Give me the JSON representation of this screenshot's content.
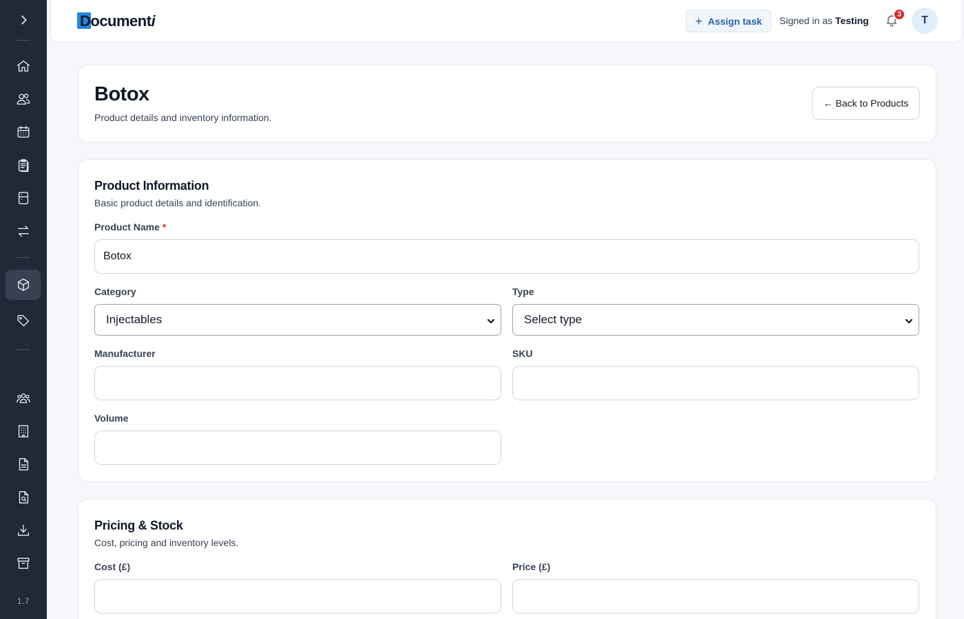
{
  "sidebar": {
    "expand_icon": "chevron-right-icon",
    "version": "1.7",
    "items": [
      {
        "name": "home",
        "icon": "home-icon"
      },
      {
        "name": "clients",
        "icon": "users-icon"
      },
      {
        "name": "calendar",
        "icon": "calendar-icon"
      },
      {
        "name": "documents",
        "icon": "clipboard-icon"
      },
      {
        "name": "records",
        "icon": "cabinet-icon"
      },
      {
        "name": "transfers",
        "icon": "arrows-icon"
      },
      {
        "name": "products",
        "icon": "box-icon",
        "active": true
      },
      {
        "name": "tags",
        "icon": "tag-icon"
      },
      {
        "name": "team",
        "icon": "group-icon"
      },
      {
        "name": "clinics",
        "icon": "building-icon"
      },
      {
        "name": "forms",
        "icon": "file-text-icon"
      },
      {
        "name": "search-docs",
        "icon": "file-search-icon"
      },
      {
        "name": "downloads",
        "icon": "download-icon"
      },
      {
        "name": "archive",
        "icon": "archive-icon"
      }
    ]
  },
  "topbar": {
    "logo_main": "Document",
    "logo_italic": "i",
    "assign_task": "Assign task",
    "signed_in_prefix": "Signed in as",
    "signed_in_user": "Testing",
    "notification_count": "3",
    "avatar_initial": "T"
  },
  "header": {
    "title": "Botox",
    "subtitle": "Product details and inventory information.",
    "back_button": "← Back to Products"
  },
  "product_info": {
    "title": "Product Information",
    "subtitle": "Basic product details and identification.",
    "product_name_label": "Product Name",
    "required_mark": "*",
    "product_name_value": "Botox",
    "category_label": "Category",
    "category_value": "Injectables",
    "type_label": "Type",
    "type_value": "Select type",
    "manufacturer_label": "Manufacturer",
    "manufacturer_value": "",
    "sku_label": "SKU",
    "sku_value": "",
    "volume_label": "Volume",
    "volume_value": ""
  },
  "pricing": {
    "title": "Pricing & Stock",
    "subtitle": "Cost, pricing and inventory levels.",
    "cost_label": "Cost (£)",
    "cost_value": "",
    "price_label": "Price (£)",
    "price_value": ""
  }
}
